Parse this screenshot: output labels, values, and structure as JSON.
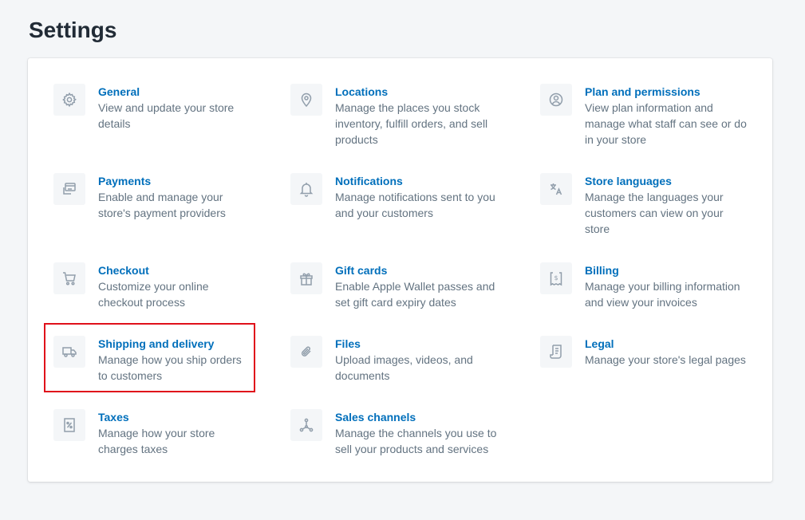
{
  "page": {
    "title": "Settings"
  },
  "settings": {
    "general": {
      "title": "General",
      "desc": "View and update your store details",
      "icon": "gear-icon"
    },
    "payments": {
      "title": "Payments",
      "desc": "Enable and manage your store's payment providers",
      "icon": "payment-icon"
    },
    "checkout": {
      "title": "Checkout",
      "desc": "Customize your online checkout process",
      "icon": "cart-icon"
    },
    "shipping": {
      "title": "Shipping and delivery",
      "desc": "Manage how you ship orders to customers",
      "icon": "truck-icon"
    },
    "taxes": {
      "title": "Taxes",
      "desc": "Manage how your store charges taxes",
      "icon": "tax-receipt-icon"
    },
    "locations": {
      "title": "Locations",
      "desc": "Manage the places you stock inventory, fulfill orders, and sell products",
      "icon": "location-pin-icon"
    },
    "notifications": {
      "title": "Notifications",
      "desc": "Manage notifications sent to you and your customers",
      "icon": "bell-icon"
    },
    "gift_cards": {
      "title": "Gift cards",
      "desc": "Enable Apple Wallet passes and set gift card expiry dates",
      "icon": "gift-icon"
    },
    "files": {
      "title": "Files",
      "desc": "Upload images, videos, and documents",
      "icon": "paperclip-icon"
    },
    "sales_channels": {
      "title": "Sales channels",
      "desc": "Manage the channels you use to sell your products and services",
      "icon": "channels-icon"
    },
    "plan": {
      "title": "Plan and permissions",
      "desc": "View plan information and manage what staff can see or do in your store",
      "icon": "user-circle-icon"
    },
    "languages": {
      "title": "Store languages",
      "desc": "Manage the languages your customers can view on your store",
      "icon": "translate-icon"
    },
    "billing": {
      "title": "Billing",
      "desc": "Manage your billing information and view your invoices",
      "icon": "billing-icon"
    },
    "legal": {
      "title": "Legal",
      "desc": "Manage your store's legal pages",
      "icon": "legal-document-icon"
    }
  },
  "colors": {
    "link": "#006fbb",
    "muted": "#637381",
    "highlight": "#e0101a",
    "icon": "#919eab"
  }
}
